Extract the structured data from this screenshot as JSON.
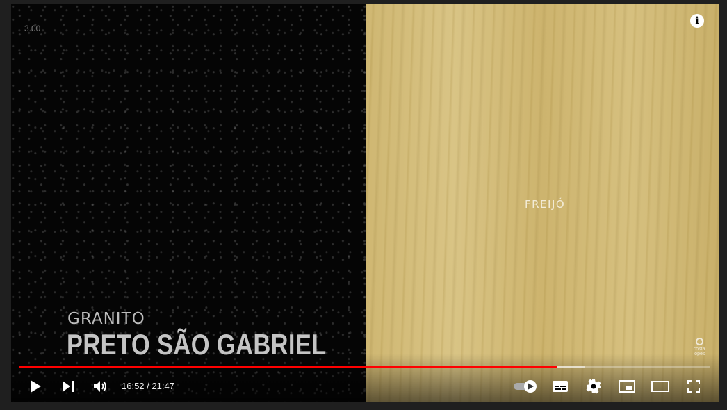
{
  "video": {
    "version_badge": "3.00",
    "caption_line1": "GRANITO",
    "caption_line2": "PRETO SÃO GABRIEL",
    "right_label": "FREIJÓ",
    "brand_text": "costa lopes",
    "info_symbol": "i"
  },
  "progress": {
    "played_fraction": 0.778,
    "buffered_fraction": 0.819,
    "played_color": "#ff0000"
  },
  "controls": {
    "current_time": "16:52",
    "separator": " / ",
    "duration": "21:47",
    "icons": [
      "play-icon",
      "next-icon",
      "volume-icon",
      "autoplay-toggle-icon",
      "subtitles-icon",
      "settings-icon",
      "miniplayer-icon",
      "theater-mode-icon",
      "fullscreen-icon"
    ]
  }
}
